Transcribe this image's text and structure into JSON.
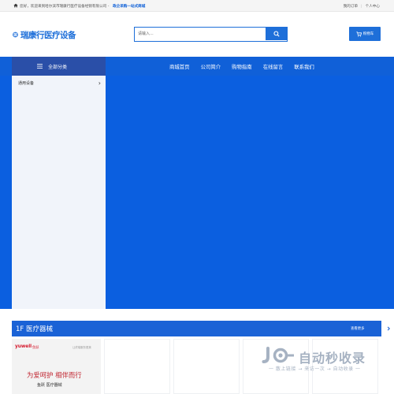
{
  "topbar": {
    "welcome": "您好，欢迎来到哈尔滨市瑞康行医疗设备经销有限公司 -",
    "slogan": "政企采购一站式商城",
    "links": [
      "我的订单",
      "个人中心"
    ]
  },
  "header": {
    "logo_text": "瑞康行医疗设备",
    "search_placeholder": "请输入..."
  },
  "cart": {
    "label": "购物车"
  },
  "nav": {
    "all_categories": "全部分类",
    "links": [
      "商城首页",
      "公司简介",
      "购物指南",
      "在线留言",
      "联系我们"
    ]
  },
  "categories": [
    {
      "label": "通用设备"
    }
  ],
  "floor": {
    "title": "1F 医疗器械",
    "more": "查看更多"
  },
  "ad": {
    "brand": "yuwell",
    "brand_cn": "鱼跃",
    "small_text": "让终端服务更美",
    "tagline": "为爱呵护 相伴而行",
    "sub": "鱼跃 医疗器械"
  },
  "watermark": {
    "text": "自动秒收录",
    "sub": "一 散上链接 → 来访一次 → 自动收录 一"
  },
  "colors": {
    "primary": "#1e6fd9",
    "nav_bg": "#1060d8",
    "hero_bg": "#0b5fe0",
    "category_header": "#2a4fa8"
  }
}
